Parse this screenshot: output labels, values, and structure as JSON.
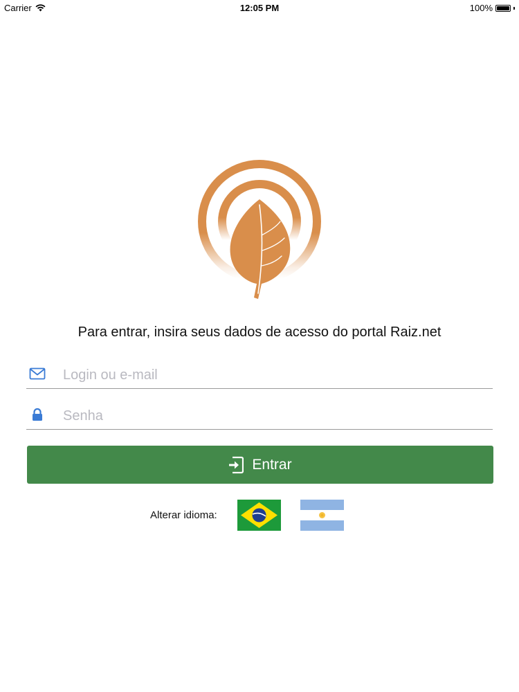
{
  "status_bar": {
    "carrier": "Carrier",
    "time": "12:05 PM",
    "battery": "100%",
    "battery_level": 1.0
  },
  "logo": {
    "icon": "raiz-leaf-logo",
    "color": "#d98e4b"
  },
  "instruction": "Para entrar, insira seus dados de acesso do portal Raiz.net",
  "login_field": {
    "icon": "envelope-icon",
    "placeholder": "Login ou e-mail",
    "value": ""
  },
  "password_field": {
    "icon": "lock-icon",
    "placeholder": "Senha",
    "value": ""
  },
  "enter_button": {
    "label": "Entrar",
    "icon": "sign-in-icon",
    "color": "#43894a"
  },
  "language": {
    "label": "Alterar idioma:",
    "options": [
      {
        "icon": "brazil-flag-icon"
      },
      {
        "icon": "argentina-flag-icon"
      }
    ]
  },
  "colors": {
    "accent_icon": "#3a7bd5",
    "field_underline": "#9a9a9a"
  }
}
